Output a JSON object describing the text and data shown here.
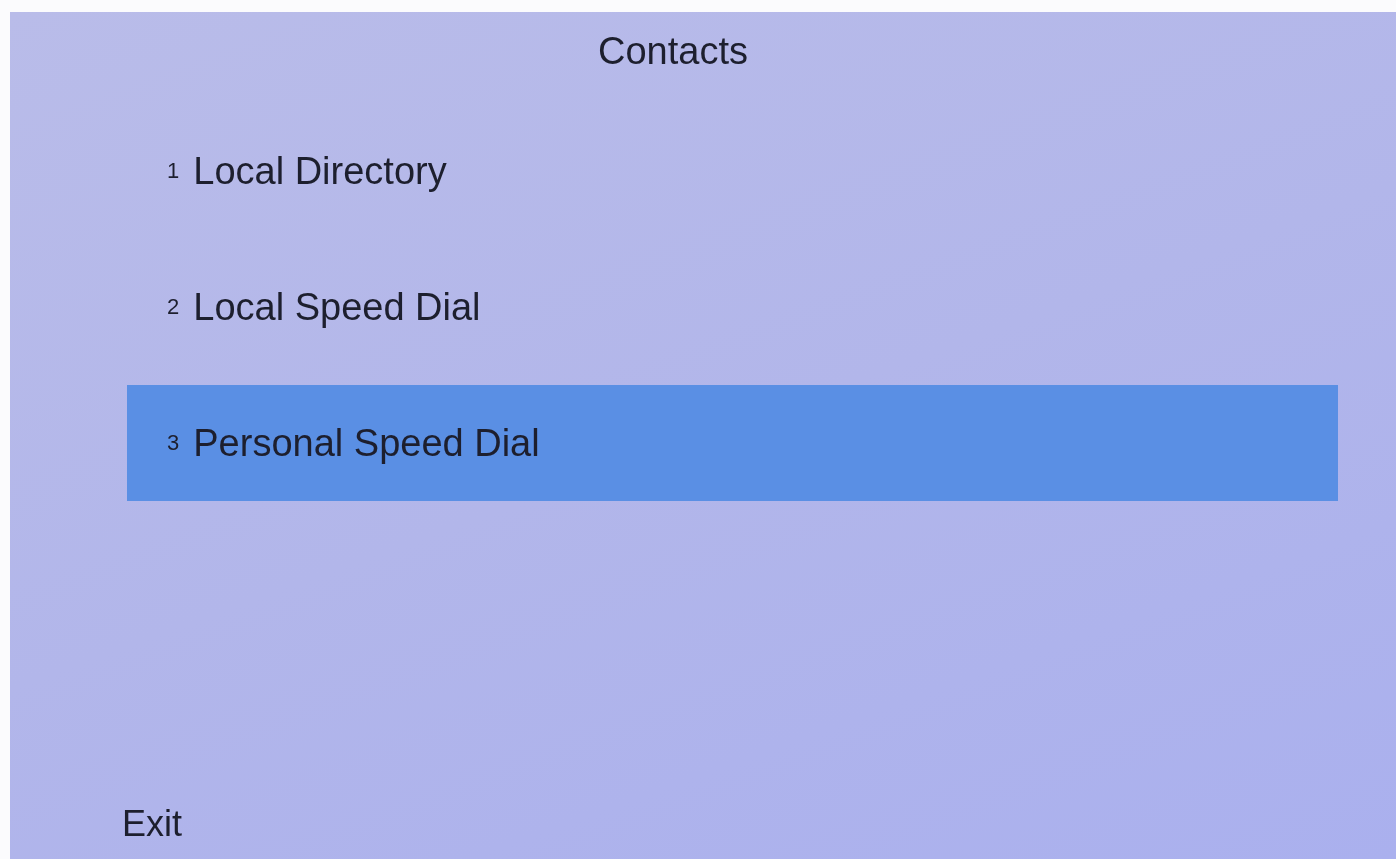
{
  "title": "Contacts",
  "items": [
    {
      "number": "1",
      "label": "Local Directory",
      "selected": false
    },
    {
      "number": "2",
      "label": "Local Speed Dial",
      "selected": false
    },
    {
      "number": "3",
      "label": "Personal Speed Dial",
      "selected": true
    }
  ],
  "softkeys": [
    "Exit"
  ]
}
